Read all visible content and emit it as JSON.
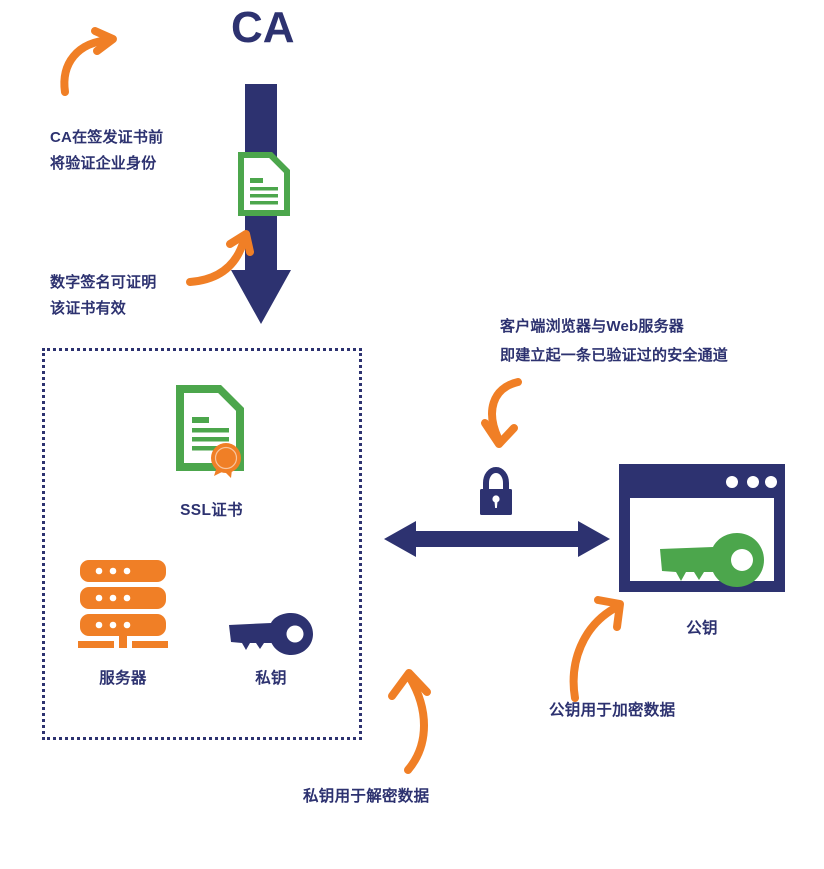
{
  "diagram": {
    "title": "CA",
    "colors": {
      "navy": "#2D3270",
      "orange": "#F07F26",
      "green": "#4CA64C",
      "white": "#FFFFFF"
    },
    "annotations": [
      {
        "id": "ca-verify",
        "text": "CA在签发证书前\n将验证企业身份"
      },
      {
        "id": "digital-signature",
        "text": "数字签名可证明\n该证书有效"
      },
      {
        "id": "secure-channel",
        "text": "客户端浏览器与Web服务器\n即建立起一条已验证过的安全通道"
      },
      {
        "id": "private-key-decrypt",
        "text": "私钥用于解密数据"
      },
      {
        "id": "public-key-encrypt",
        "text": "公钥用于加密数据"
      }
    ],
    "icon_captions": {
      "ssl_certificate": "SSL证书",
      "server": "服务器",
      "private_key": "私钥",
      "public_key": "公钥"
    },
    "icons": {
      "ca_document": "document-icon",
      "ssl_certificate": "certificate-seal-icon",
      "server": "server-stack-icon",
      "private_key": "key-icon",
      "padlock": "lock-icon",
      "browser": "browser-window-icon",
      "public_key": "key-icon",
      "ca_flow_arrow": "down-arrow-icon",
      "channel_arrow": "double-headed-arrow-icon"
    }
  }
}
